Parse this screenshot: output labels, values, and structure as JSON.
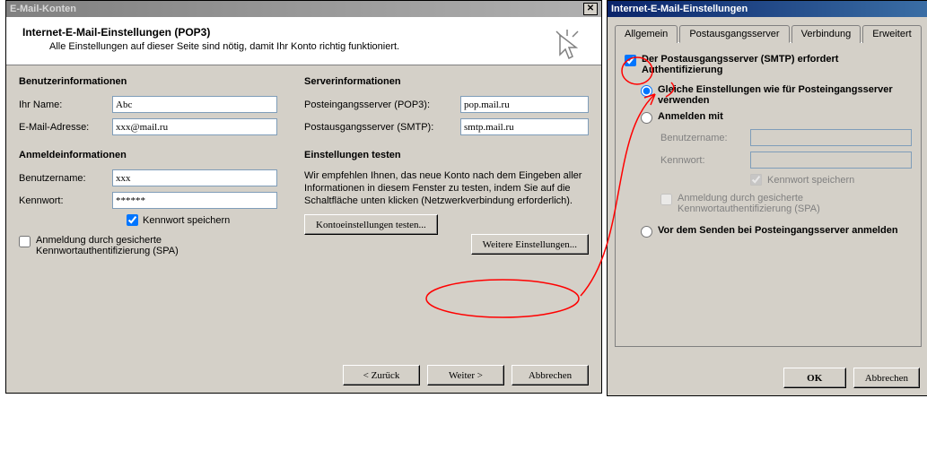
{
  "left": {
    "title": "E-Mail-Konten",
    "head_title": "Internet-E-Mail-Einstellungen (POP3)",
    "head_sub": "Alle Einstellungen auf dieser Seite sind nötig, damit Ihr Konto richtig funktioniert.",
    "section_user": "Benutzerinformationen",
    "name_label": "Ihr Name:",
    "name_value": "Abc",
    "email_label": "E-Mail-Adresse:",
    "email_value": "xxx@mail.ru",
    "section_login": "Anmeldeinformationen",
    "user_label": "Benutzername:",
    "user_value": "xxx",
    "pass_label": "Kennwort:",
    "pass_value": "******",
    "save_pass": "Kennwort speichern",
    "spa": "Anmeldung durch gesicherte Kennwortauthentifizierung (SPA)",
    "section_server": "Serverinformationen",
    "pop_label": "Posteingangsserver (POP3):",
    "pop_value": "pop.mail.ru",
    "smtp_label": "Postausgangsserver (SMTP):",
    "smtp_value": "smtp.mail.ru",
    "section_test": "Einstellungen testen",
    "test_desc": "Wir empfehlen Ihnen, das neue Konto nach dem Eingeben aller Informationen in diesem Fenster zu testen, indem Sie auf die Schaltfläche unten klicken (Netzwerkverbindung erforderlich).",
    "btn_test": "Kontoeinstellungen testen...",
    "btn_more": "Weitere Einstellungen...",
    "btn_back": "< Zurück",
    "btn_next": "Weiter >",
    "btn_cancel": "Abbrechen"
  },
  "right": {
    "title": "Internet-E-Mail-Einstellungen",
    "tabs": {
      "general": "Allgemein",
      "outgoing": "Postausgangsserver",
      "connection": "Verbindung",
      "advanced": "Erweitert"
    },
    "smtp_auth": "Der Postausgangsserver (SMTP) erfordert Authentifizierung",
    "same_settings": "Gleiche Einstellungen wie für Posteingangsserver verwenden",
    "login_with": "Anmelden mit",
    "user_label": "Benutzername:",
    "user_value": "",
    "pass_label": "Kennwort:",
    "pass_value": "",
    "save_pass": "Kennwort speichern",
    "spa": "Anmeldung durch gesicherte Kennwortauthentifizierung (SPA)",
    "before_send": "Vor dem Senden bei Posteingangsserver anmelden",
    "btn_ok": "OK",
    "btn_cancel": "Abbrechen"
  }
}
